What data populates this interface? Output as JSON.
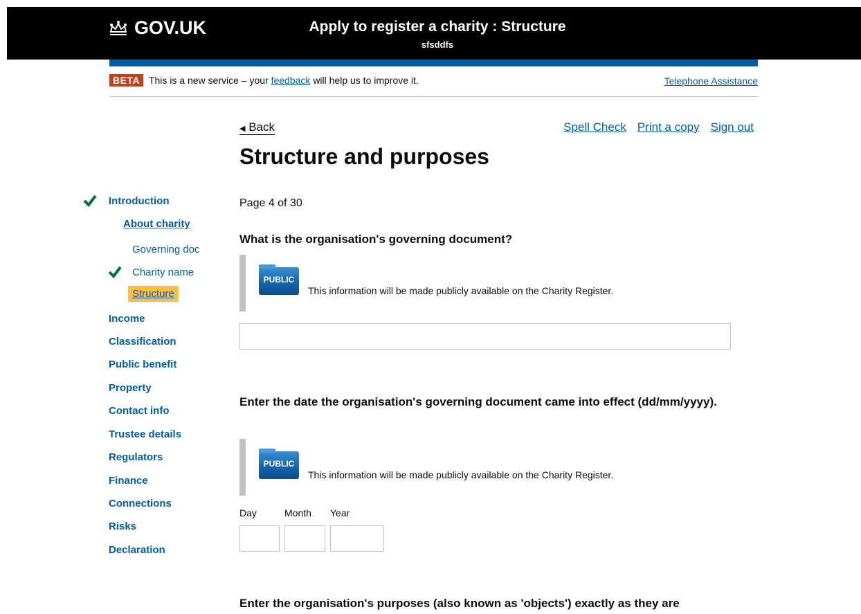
{
  "header": {
    "logo_text": "GOV.UK",
    "service_title": "Apply to register a charity : Structure",
    "service_subtitle": "sfsddfs"
  },
  "beta": {
    "tag": "BETA",
    "text_before": "This is a new service – your",
    "feedback_link": "feedback",
    "text_after": "will help us to improve it.",
    "telephone_link": "Telephone Assistance"
  },
  "top_links": {
    "back": "Back",
    "spell_check": "Spell Check",
    "print": "Print a copy",
    "sign_out": "Sign out"
  },
  "page": {
    "title": "Structure and purposes",
    "page_info": "Page 4 of 30"
  },
  "nav": {
    "introduction": "Introduction",
    "about_charity": "About charity",
    "governing_doc": "Governing doc",
    "charity_name": "Charity name",
    "structure": "Structure",
    "income": "Income",
    "classification": "Classification",
    "public_benefit": "Public benefit",
    "property": "Property",
    "contact_info": "Contact info",
    "trustee_details": "Trustee details",
    "regulators": "Regulators",
    "finance": "Finance",
    "connections": "Connections",
    "risks": "Risks",
    "declaration": "Declaration"
  },
  "q1": {
    "label": "What is the organisation's governing document?",
    "badge": "PUBLIC",
    "notice": "This information will be made publicly available on the Charity Register.",
    "value": ""
  },
  "q2": {
    "label": "Enter the date the organisation's governing document came into effect (dd/mm/yyyy).",
    "badge": "PUBLIC",
    "notice": "This information will be made publicly available on the Charity Register.",
    "day_label": "Day",
    "month_label": "Month",
    "year_label": "Year",
    "day_value": "",
    "month_value": "",
    "year_value": ""
  },
  "q3": {
    "label": "Enter the organisation's purposes (also known as 'objects') exactly as they are"
  },
  "colors": {
    "header_bg": "#000000",
    "brand_blue": "#005ea5",
    "beta_tag": "#c7401d",
    "current_highlight": "#ffbf47",
    "check_green": "#00703c"
  }
}
